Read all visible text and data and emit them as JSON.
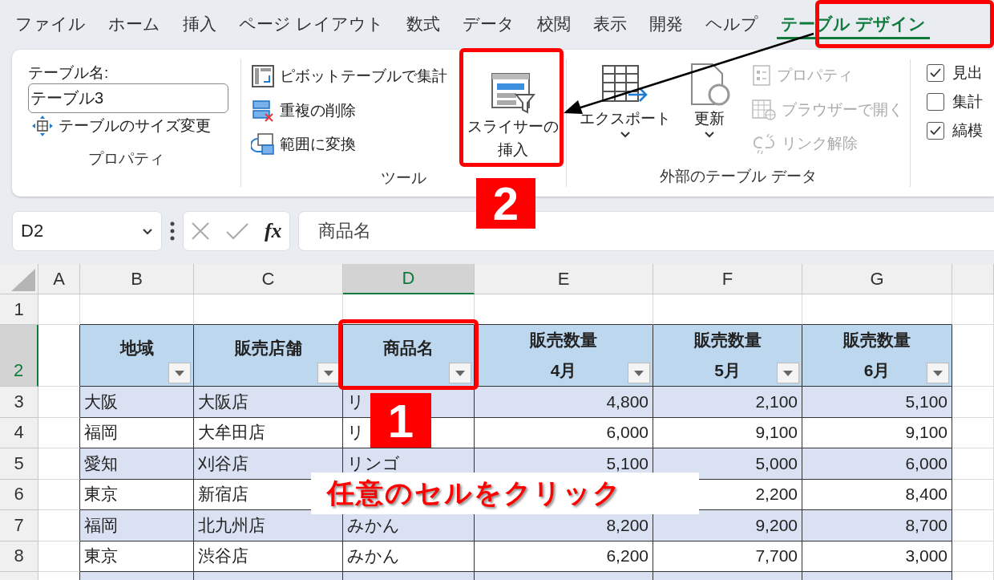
{
  "menu_tabs": [
    {
      "label": "ファイル",
      "selected": false
    },
    {
      "label": "ホーム",
      "selected": false
    },
    {
      "label": "挿入",
      "selected": false
    },
    {
      "label": "ページ レイアウト",
      "selected": false
    },
    {
      "label": "数式",
      "selected": false
    },
    {
      "label": "データ",
      "selected": false
    },
    {
      "label": "校閲",
      "selected": false
    },
    {
      "label": "表示",
      "selected": false
    },
    {
      "label": "開発",
      "selected": false
    },
    {
      "label": "ヘルプ",
      "selected": false
    },
    {
      "label": "テーブル デザイン",
      "selected": true
    }
  ],
  "properties_group": {
    "label": "プロパティ",
    "name_label": "テーブル名:",
    "name_value": "テーブル3",
    "resize": "テーブルのサイズ変更"
  },
  "tools_group": {
    "label": "ツール",
    "slicer": "スライサーの挿入",
    "commands": [
      {
        "label": "ピボットテーブルで集計",
        "kind": "pivot"
      },
      {
        "label": "重複の削除",
        "kind": "dedupe"
      },
      {
        "label": "範囲に変換",
        "kind": "convert"
      }
    ]
  },
  "external_group": {
    "label": "外部のテーブル データ",
    "large": [
      {
        "label": "エクスポート",
        "kind": "export"
      },
      {
        "label": "更新",
        "kind": "refresh"
      }
    ],
    "commands": [
      {
        "label": "プロパティ",
        "kind": "properties",
        "disabled": true
      },
      {
        "label": "ブラウザーで開く",
        "kind": "browser",
        "disabled": true
      },
      {
        "label": "リンク解除",
        "kind": "unlink",
        "disabled": true
      }
    ]
  },
  "style_options": [
    {
      "label": "見出",
      "checked": true
    },
    {
      "label": "集計",
      "checked": false
    },
    {
      "label": "縞模",
      "checked": true
    }
  ],
  "formula_bar": {
    "name_box": "D2",
    "fx": "fx",
    "value": "商品名"
  },
  "sheet": {
    "columns": [
      {
        "label": "A",
        "selected": false
      },
      {
        "label": "B",
        "selected": false
      },
      {
        "label": "C",
        "selected": false
      },
      {
        "label": "D",
        "selected": true
      },
      {
        "label": "E",
        "selected": false
      },
      {
        "label": "F",
        "selected": false
      },
      {
        "label": "G",
        "selected": false
      }
    ],
    "row_numbers": [
      {
        "label": "1",
        "selected": false
      },
      {
        "label": "2",
        "selected": true
      },
      {
        "label": "3",
        "selected": false
      },
      {
        "label": "4",
        "selected": false
      },
      {
        "label": "5",
        "selected": false
      },
      {
        "label": "6",
        "selected": false
      },
      {
        "label": "7",
        "selected": false
      },
      {
        "label": "8",
        "selected": false
      }
    ],
    "table": {
      "headers": [
        "地域",
        "販売店舗",
        "商品名",
        "販売数量\n4月",
        "販売数量\n5月",
        "販売数量\n6月"
      ],
      "rows": [
        {
          "region": "大阪",
          "store": "大阪店",
          "product": "リ",
          "apr": "4,800",
          "may": "2,100",
          "jun": "5,100"
        },
        {
          "region": "福岡",
          "store": "大牟田店",
          "product": "リ",
          "apr": "6,000",
          "may": "9,100",
          "jun": "9,100"
        },
        {
          "region": "愛知",
          "store": "刈谷店",
          "product": "リンゴ",
          "apr": "5,100",
          "may": "5,000",
          "jun": "6,000"
        },
        {
          "region": "東京",
          "store": "新宿店",
          "may": "2,200",
          "jun": "8,400"
        },
        {
          "region": "福岡",
          "store": "北九州店",
          "product": "みかん",
          "apr": "8,200",
          "may": "9,200",
          "jun": "8,700"
        },
        {
          "region": "東京",
          "store": "渋谷店",
          "product": "みかん",
          "apr": "6,200",
          "may": "7,700",
          "jun": "3,000"
        }
      ]
    }
  },
  "annotations": {
    "badges": [
      "1",
      "2"
    ],
    "note": "任意のセルをクリック"
  }
}
